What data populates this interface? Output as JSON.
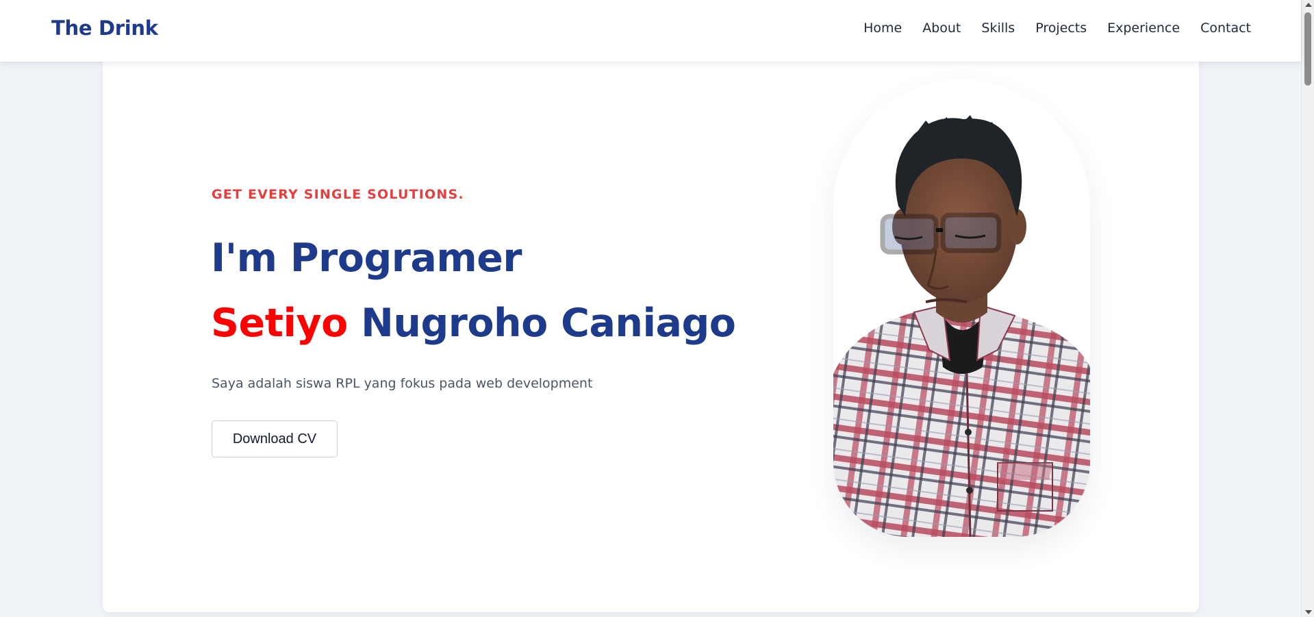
{
  "navbar": {
    "brand": "The Drink",
    "links": [
      {
        "label": "Home"
      },
      {
        "label": "About"
      },
      {
        "label": "Skills"
      },
      {
        "label": "Projects"
      },
      {
        "label": "Experience"
      },
      {
        "label": "Contact"
      }
    ]
  },
  "hero": {
    "tagline": "GET EVERY SINGLE SOLUTIONS.",
    "headline": "I'm Programer",
    "name_first": "Setiyo",
    "name_rest": "Nugroho Caniago",
    "description": "Saya adalah siswa RPL yang fokus pada web development",
    "cv_button_label": "Download CV",
    "photo_icon": "profile-photo"
  },
  "colors": {
    "brand": "#1e3a8a",
    "tagline": "#e53e3e",
    "name_accent": "#ff0000",
    "page_background": "#eff2f7"
  }
}
